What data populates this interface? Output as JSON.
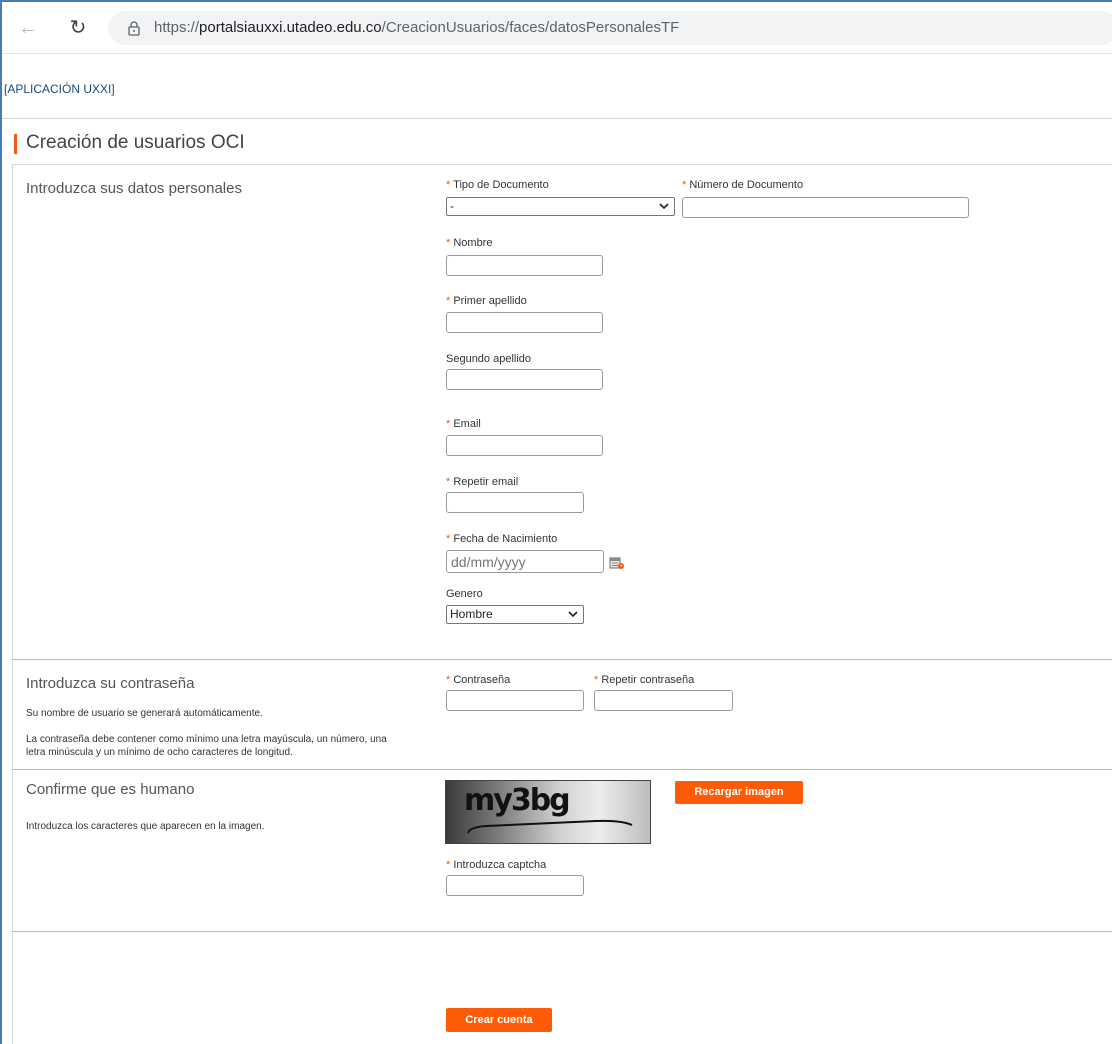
{
  "browser": {
    "url_prefix": "https://",
    "url_host": "portalsiauxxi.utadeo.edu.co",
    "url_path": "/CreacionUsuarios/faces/datosPersonalesTF"
  },
  "header": {
    "brand": "[APLICACIÓN UXXI]",
    "page_title": "Creación de usuarios OCI"
  },
  "accent_color": "#fd5b06",
  "personal": {
    "title": "Introduzca sus datos personales",
    "tipo_documento": {
      "label": "Tipo de Documento",
      "value": "-"
    },
    "numero_documento": {
      "label": "Número de Documento",
      "value": ""
    },
    "nombre": {
      "label": "Nombre",
      "value": ""
    },
    "primer_apellido": {
      "label": "Primer apellido",
      "value": ""
    },
    "segundo_apellido": {
      "label": "Segundo apellido",
      "value": ""
    },
    "email": {
      "label": "Email",
      "value": ""
    },
    "repetir_email": {
      "label": "Repetir email",
      "value": ""
    },
    "fecha_nacimiento": {
      "label": "Fecha de Nacimiento",
      "placeholder": "dd/mm/yyyy"
    },
    "genero": {
      "label": "Genero",
      "value": "Hombre"
    }
  },
  "password": {
    "title": "Introduzca su contraseña",
    "desc1": "Su nombre de usuario se generará automáticamente.",
    "desc2_line1": "La contraseña debe contener como mínimo una letra mayúscula, un número, una",
    "desc2_line2": "letra minúscula y un mínimo de ocho caracteres de longitud.",
    "contrasena": {
      "label": "Contraseña"
    },
    "repetir_contrasena": {
      "label": "Repetir contraseña"
    }
  },
  "captcha": {
    "title": "Confirme que es humano",
    "desc": "Introduzca los caracteres que aparecen en la imagen.",
    "image_text": "my3bg",
    "reload_label": "Recargar imagen",
    "input": {
      "label": "Introduzca captcha",
      "value": ""
    }
  },
  "submit": {
    "label": "Crear cuenta"
  },
  "required_marker": "*"
}
